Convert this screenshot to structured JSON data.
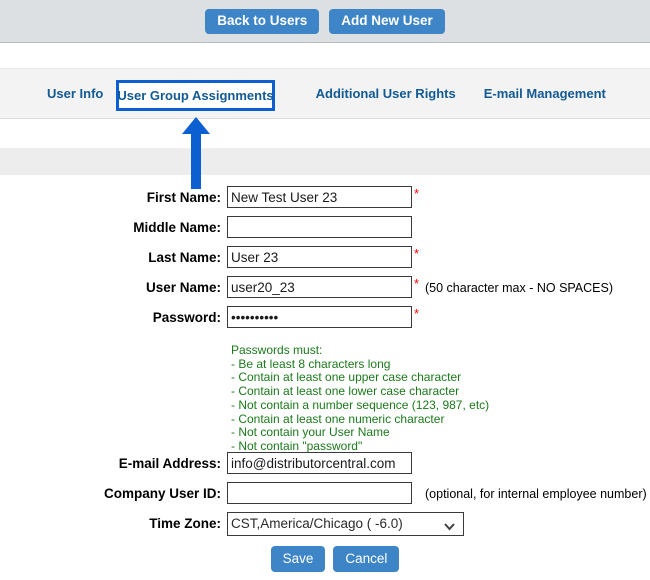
{
  "toolbar": {
    "back_to_users_label": "Back to Users",
    "add_new_user_label": "Add New User"
  },
  "tabs": [
    {
      "label": "User Info",
      "active": false
    },
    {
      "label": "User Group Assignments",
      "active": true
    },
    {
      "label": "Additional User Rights",
      "active": false
    },
    {
      "label": "E-mail Management",
      "active": false
    }
  ],
  "annotation": {
    "arrow_name": "up-arrow-annotation",
    "color": "#0b5fd0",
    "points_to": "User Group Assignments"
  },
  "form": {
    "first_name": {
      "label": "First Name:",
      "value": "New Test User 23",
      "placeholder": "",
      "required_marker": "*"
    },
    "middle_name": {
      "label": "Middle Name:",
      "value": "",
      "placeholder": "",
      "required_marker": ""
    },
    "last_name": {
      "label": "Last Name:",
      "value": "User 23",
      "placeholder": "",
      "required_marker": "*"
    },
    "user_name": {
      "label": "User Name:",
      "value": "user20_23",
      "placeholder": "",
      "required_marker": "*",
      "hint": "(50 character max - NO SPACES)"
    },
    "password": {
      "label": "Password:",
      "value": "••••••••••",
      "placeholder": "",
      "required_marker": "*"
    },
    "email_address": {
      "label": "E-mail Address:",
      "value": "info@distributorcentral.com",
      "placeholder": "",
      "required_marker": ""
    },
    "company_user_id": {
      "label": "Company User ID:",
      "value": "",
      "placeholder": "",
      "required_marker": "",
      "hint": "(optional, for internal employee number)"
    },
    "time_zone": {
      "label": "Time Zone:",
      "selected": "CST,America/Chicago ( -6.0)",
      "chevron_icon": "chevron-down-icon"
    }
  },
  "password_rules": {
    "heading": "Passwords must:",
    "items": [
      "- Be at least 8 characters long",
      "- Contain at least one upper case character",
      "- Contain at least one lower case character",
      "- Not contain a number sequence (123, 987, etc)",
      "- Contain at least one numeric character",
      "- Not contain your User Name",
      "- Not contain \"password\""
    ],
    "color": "#1a7a1a"
  },
  "actions": {
    "save_label": "Save",
    "cancel_label": "Cancel"
  },
  "colors": {
    "button_blue": "#3d85c6",
    "tab_link": "#125a94",
    "highlight_blue": "#0b5fd0",
    "required_red": "#ff0000",
    "rules_green": "#1a7a1a",
    "top_band": "#dde0e3",
    "tab_strip": "#f3f3f3",
    "gray_band": "#ededed"
  }
}
